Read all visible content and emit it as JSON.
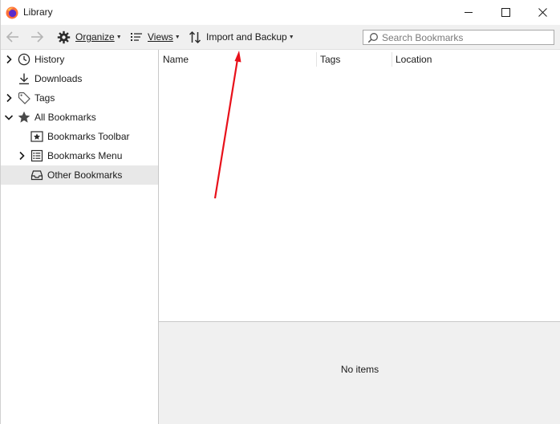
{
  "window": {
    "title": "Library"
  },
  "toolbar": {
    "back_icon": "arrow-left-icon",
    "forward_icon": "arrow-right-icon",
    "organize_label": "Organize",
    "organize_icon": "gear-icon",
    "views_label": "Views",
    "views_icon": "list-icon",
    "import_label": "Import and Backup",
    "import_icon": "up-down-arrows-icon",
    "search_placeholder": "Search Bookmarks"
  },
  "sidebar": {
    "items": [
      {
        "label": "History",
        "icon": "clock-icon",
        "twisty": "collapsed"
      },
      {
        "label": "Downloads",
        "icon": "download-icon",
        "twisty": "none"
      },
      {
        "label": "Tags",
        "icon": "tag-icon",
        "twisty": "collapsed"
      },
      {
        "label": "All Bookmarks",
        "icon": "star-icon",
        "twisty": "expanded"
      },
      {
        "label": "Bookmarks Toolbar",
        "icon": "bookmarks-toolbar-icon",
        "twisty": "none"
      },
      {
        "label": "Bookmarks Menu",
        "icon": "bookmarks-menu-icon",
        "twisty": "collapsed"
      },
      {
        "label": "Other Bookmarks",
        "icon": "tray-icon",
        "twisty": "none",
        "selected": true
      }
    ]
  },
  "table": {
    "columns": [
      "Name",
      "Tags",
      "Location"
    ]
  },
  "details": {
    "empty_text": "No items"
  },
  "colors": {
    "toolbar_bg": "#f0f0f0",
    "selected_bg": "#e8e8e8",
    "annotation_arrow": "#e8101a"
  }
}
